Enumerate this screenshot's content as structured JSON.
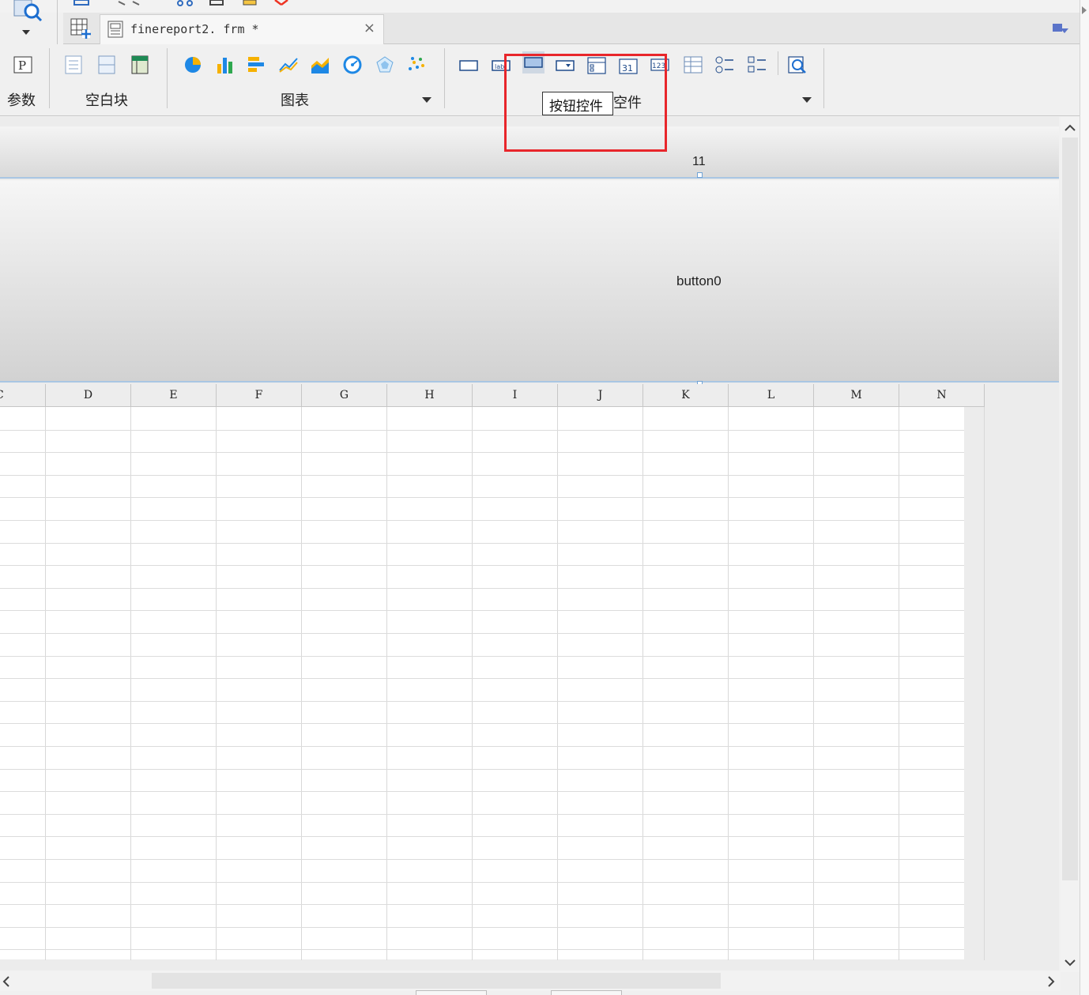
{
  "tab": {
    "title": "finereport2. frm *",
    "close": "×"
  },
  "ribbon": {
    "groups": [
      {
        "name": "param",
        "label": "参数"
      },
      {
        "name": "blank",
        "label": "空白块"
      },
      {
        "name": "chart",
        "label": "图表"
      },
      {
        "name": "widgets",
        "label": "控件"
      }
    ],
    "tooltip": "按钮控件",
    "partial_label": "空件"
  },
  "canvas": {
    "ruler_number": "11",
    "button_text": "button0"
  },
  "sheet": {
    "columns": [
      "C",
      "D",
      "E",
      "F",
      "G",
      "H",
      "I",
      "J",
      "K",
      "L",
      "M",
      "N"
    ]
  },
  "colors": {
    "highlight": "#e8262b",
    "selection_border": "#a9c6e3"
  },
  "icons": {
    "chart_types": [
      "pie-chart-icon",
      "bar-chart-icon",
      "horizontal-bar-icon",
      "line-chart-icon",
      "area-chart-icon",
      "gauge-chart-icon",
      "radar-chart-icon",
      "scatter-chart-icon"
    ],
    "widget_types": [
      "text-widget-icon",
      "label-widget-icon",
      "button-widget-icon",
      "combo-widget-icon",
      "tree-widget-icon",
      "date-widget-icon",
      "number-widget-icon",
      "table-widget-icon",
      "radio-group-icon",
      "checkbox-group-icon",
      "search-widget-icon"
    ]
  }
}
